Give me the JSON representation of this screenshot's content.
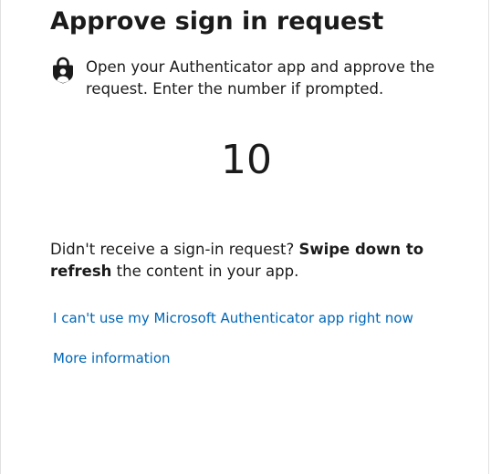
{
  "title": "Approve sign in request",
  "instruction": {
    "icon": "authenticator-lock-icon",
    "text": "Open your Authenticator app and approve the request. Enter the number if prompted."
  },
  "number": "10",
  "help": {
    "prefix": "Didn't receive a sign-in request? ",
    "bold": "Swipe down to refresh",
    "suffix": " the content in your app."
  },
  "links": {
    "cant_use": "I can't use my Microsoft Authenticator app right now",
    "more_info": "More information"
  },
  "colors": {
    "link": "#0067b8",
    "text": "#1b1b1b"
  }
}
